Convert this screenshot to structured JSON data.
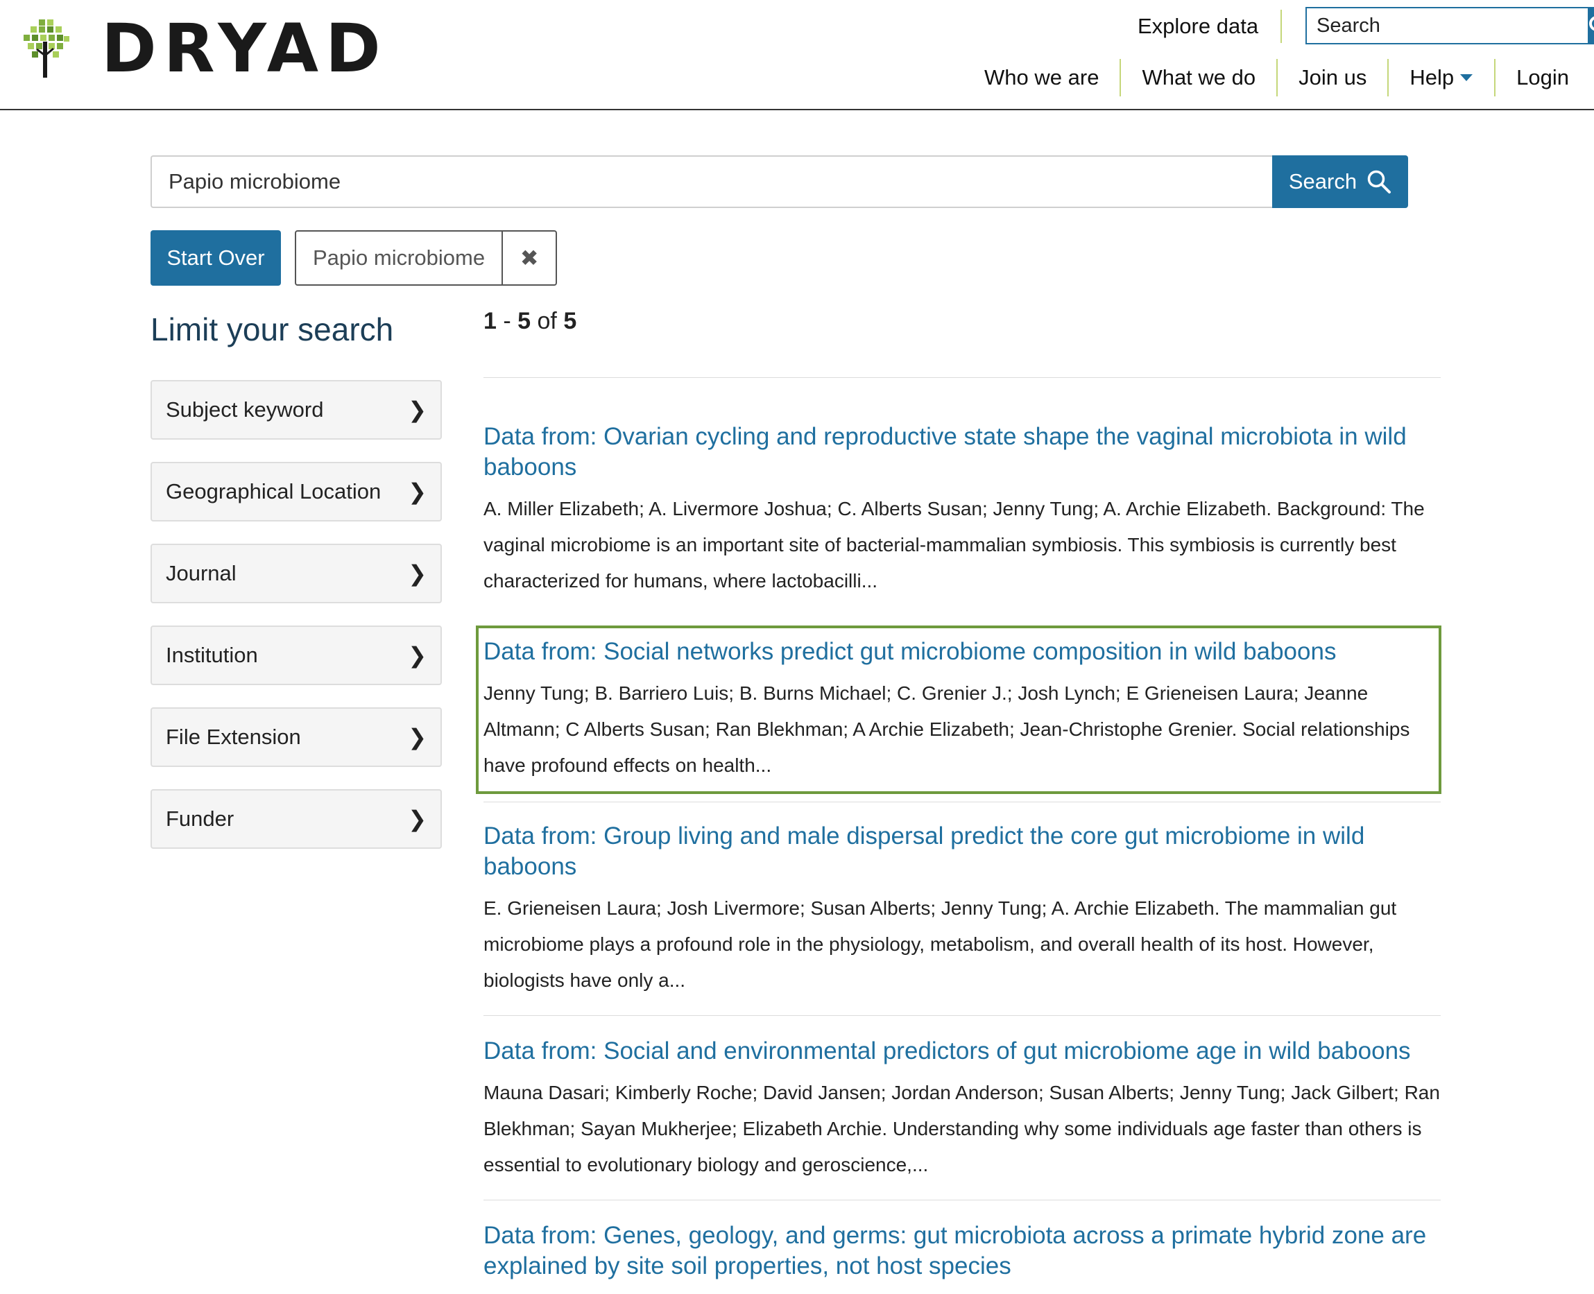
{
  "header": {
    "brand": "DRYAD",
    "explore_label": "Explore data",
    "search_placeholder": "Search",
    "nav": [
      "Who we are",
      "What we do",
      "Join us",
      "Help",
      "Login"
    ]
  },
  "search": {
    "query": "Papio microbiome",
    "button_label": "Search",
    "start_over_label": "Start Over",
    "constraint": "Papio microbiome",
    "remove_glyph": "✖"
  },
  "sidebar": {
    "title": "Limit your search",
    "facets": [
      "Subject keyword",
      "Geographical Location",
      "Journal",
      "Institution",
      "File Extension",
      "Funder"
    ],
    "chevron": "❯"
  },
  "results": {
    "count": {
      "start": "1",
      "sep": " - ",
      "end": "5",
      "of": " of ",
      "total": "5"
    },
    "items": [
      {
        "title": "Data from: Ovarian cycling and reproductive state shape the vaginal microbiota in wild baboons",
        "snippet": "A. Miller Elizabeth; A. Livermore Joshua; C. Alberts Susan; Jenny Tung; A. Archie Elizabeth. Background: The vaginal microbiome is an important site of bacterial-mammalian symbiosis. This symbiosis is currently best characterized for humans, where lactobacilli..."
      },
      {
        "title": "Data from: Social networks predict gut microbiome composition in wild baboons",
        "snippet": "Jenny Tung; B. Barriero Luis; B. Burns Michael; C. Grenier J.; Josh Lynch; E Grieneisen Laura; Jeanne Altmann; C Alberts Susan; Ran Blekhman; A Archie Elizabeth; Jean-Christophe Grenier. Social relationships have profound effects on health..."
      },
      {
        "title": "Data from: Group living and male dispersal predict the core gut microbiome in wild baboons",
        "snippet": "E. Grieneisen Laura; Josh Livermore; Susan Alberts; Jenny Tung; A. Archie Elizabeth. The mammalian gut microbiome plays a profound role in the physiology, metabolism, and overall health of its host. However, biologists have only a..."
      },
      {
        "title": "Data from: Social and environmental predictors of gut microbiome age in wild baboons",
        "snippet": "Mauna Dasari; Kimberly Roche; David Jansen; Jordan Anderson; Susan Alberts; Jenny Tung; Jack Gilbert; Ran Blekhman; Sayan Mukherjee; Elizabeth Archie. Understanding why some individuals age faster than others is essential to evolutionary biology and geroscience,..."
      },
      {
        "title": "Data from: Genes, geology, and germs: gut microbiota across a primate hybrid zone are explained by site soil properties, not host species",
        "snippet": ""
      }
    ]
  },
  "colors": {
    "accent": "#1f6f9f",
    "brand_green": "#6e9a3d",
    "divider": "#c5d77a"
  },
  "icons": {
    "logo": "tree-logo-icon",
    "search": "search-icon",
    "caret": "caret-down-icon"
  }
}
